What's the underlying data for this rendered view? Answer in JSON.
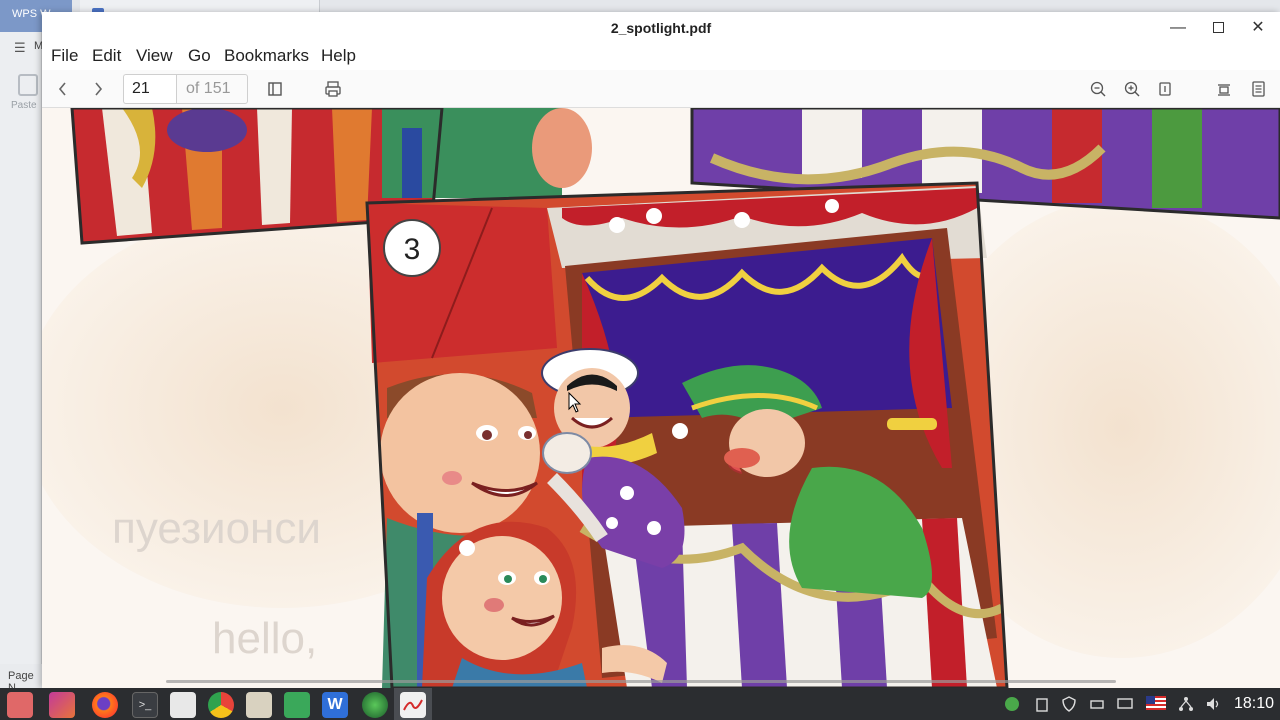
{
  "background_app": {
    "tab_label": "WPS W",
    "menu_label": "M",
    "paste_label": "Paste",
    "page_label": "Page N"
  },
  "window": {
    "title": "2_spotlight.pdf"
  },
  "menu": {
    "items": [
      "File",
      "Edit",
      "View",
      "Go",
      "Bookmarks",
      "Help"
    ]
  },
  "toolbar": {
    "current_page": "21",
    "page_total": "of 151"
  },
  "document": {
    "panel_number": "3",
    "bg_text_1": "пуезионси",
    "bg_text_2": "hello,"
  },
  "taskbar": {
    "clock": "18:10",
    "apps": [
      "files-icon",
      "gradient-app-icon",
      "firefox-icon",
      "terminal-icon",
      "file-manager-icon",
      "chrome-icon",
      "book-reader-icon",
      "spreadsheet-icon",
      "wps-writer-icon",
      "globe-app-icon",
      "pdf-viewer-icon"
    ]
  },
  "colors": {
    "taskbar_bg": "#2b2d30",
    "accent_tab": "#7c98c8"
  }
}
